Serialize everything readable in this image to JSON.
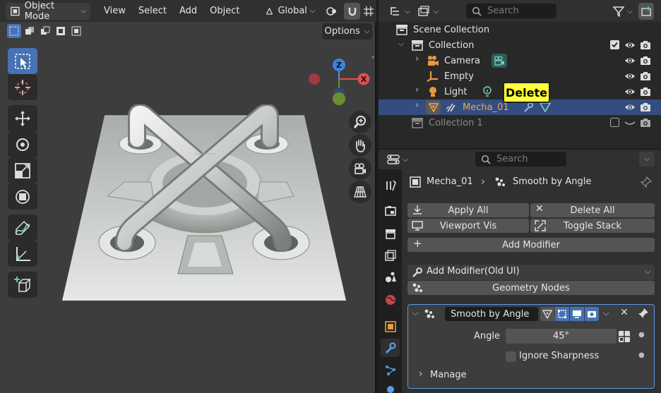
{
  "viewport": {
    "mode": "Object Mode",
    "menus": [
      "View",
      "Select",
      "Add",
      "Object"
    ],
    "transform_orientation": "Global",
    "options_label": "Options",
    "gizmo": {
      "z": "Z",
      "x": "X"
    }
  },
  "outliner": {
    "search_placeholder": "Search",
    "root": "Scene Collection",
    "collection": "Collection",
    "items": [
      "Camera",
      "Empty",
      "Light",
      "Mecha_01"
    ],
    "collection2": "Collection 1"
  },
  "tooltip": {
    "text": "Delete"
  },
  "properties": {
    "search_placeholder": "Search",
    "breadcrumb_object": "Mecha_01",
    "breadcrumb_modifier": "Smooth by Angle",
    "buttons": {
      "apply_all": "Apply All",
      "delete_all": "Delete All",
      "viewport_vis": "Viewport Vis",
      "toggle_stack": "Toggle Stack",
      "add_modifier": "Add Modifier",
      "add_modifier_old": "Add Modifier(Old UI)",
      "geometry_nodes": "Geometry Nodes"
    },
    "modifier": {
      "name": "Smooth by Angle",
      "angle_label": "Angle",
      "angle_value": "45°",
      "ignore_sharpness": "Ignore Sharpness",
      "manage": "Manage"
    }
  },
  "colors": {
    "accent": "#4772b3",
    "selected_row": "#334d80",
    "orange_text": "#f0a550",
    "tooltip_bg": "#ffff3a"
  }
}
